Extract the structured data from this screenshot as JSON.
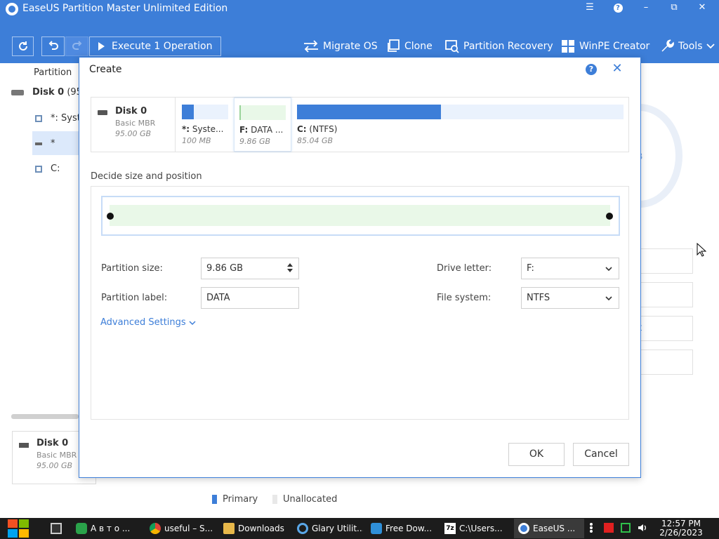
{
  "window": {
    "title": "EaseUS Partition Master Unlimited Edition",
    "controls": {
      "menu": "☰",
      "help": "?",
      "minimize": "–",
      "maximize": "⧉",
      "close": "✕"
    }
  },
  "toolbar": {
    "execute_label": "Execute 1 Operation",
    "items": {
      "migrate": "Migrate OS",
      "clone": "Clone",
      "recovery": "Partition Recovery",
      "winpe": "WinPE Creator",
      "tools": "Tools"
    }
  },
  "background": {
    "partition_heading": "Partition",
    "tree": {
      "disk": "Disk 0",
      "disk_suffix": "(95",
      "sys": "*: Syst",
      "star": "*",
      "c": "C:"
    },
    "card": {
      "name": "Disk 0",
      "type": "Basic MBR",
      "size": "95.00 GB"
    },
    "ring_text": "B",
    "right_box_text": "t",
    "legend": {
      "primary": "Primary",
      "unallocated": "Unallocated"
    }
  },
  "dialog": {
    "title": "Create",
    "help": "?",
    "close": "✕",
    "disk": {
      "name": "Disk 0",
      "type": "Basic MBR",
      "size": "95.00 GB"
    },
    "partitions": [
      {
        "bold": "*:",
        "label": " Syste...",
        "size": "100 MB",
        "used": 0.25
      },
      {
        "bold": "F:",
        "label": " DATA ...",
        "size": "9.86 GB",
        "used": 0.02
      },
      {
        "bold": "C:",
        "label": " (NTFS)",
        "size": "85.04 GB",
        "used": 0.44
      }
    ],
    "section_label": "Decide size and position",
    "fields": {
      "partition_size_label": "Partition size:",
      "partition_size_value": "9.86 GB",
      "partition_label_label": "Partition label:",
      "partition_label_value": "DATA",
      "drive_letter_label": "Drive letter:",
      "drive_letter_value": "F:",
      "file_system_label": "File system:",
      "file_system_value": "NTFS"
    },
    "advanced": "Advanced Settings",
    "ok": "OK",
    "cancel": "Cancel"
  },
  "taskbar": {
    "items": [
      {
        "label": "",
        "icon": "window-icon"
      },
      {
        "label": "А в т о ...",
        "icon": "chat-icon"
      },
      {
        "label": "useful – S...",
        "icon": "chrome-icon"
      },
      {
        "label": "Downloads",
        "icon": "folder-icon"
      },
      {
        "label": "Glary Utilit...",
        "icon": "glary-icon"
      },
      {
        "label": "Free Dow...",
        "icon": "download-icon"
      },
      {
        "label": "C:\\Users...",
        "icon": "7zip-icon"
      },
      {
        "label": "EaseUS ...",
        "icon": "easeus-icon"
      }
    ],
    "time": "12:57 PM",
    "date": "2/26/2023"
  },
  "colors": {
    "brand": "#3d7ed8",
    "unallocated": "#e9f8e8",
    "primary": "#3d7ed8"
  }
}
